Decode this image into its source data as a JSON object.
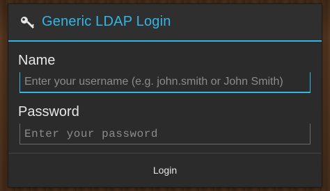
{
  "dialog": {
    "title": "Generic LDAP Login",
    "title_icon": "key-icon",
    "accent_color": "#33b5e5"
  },
  "form": {
    "name_label": "Name",
    "name_placeholder": "Enter your username (e.g. john.smith or John Smith)",
    "password_label": "Password",
    "password_placeholder": "Enter your password"
  },
  "actions": {
    "login_label": "Login"
  }
}
